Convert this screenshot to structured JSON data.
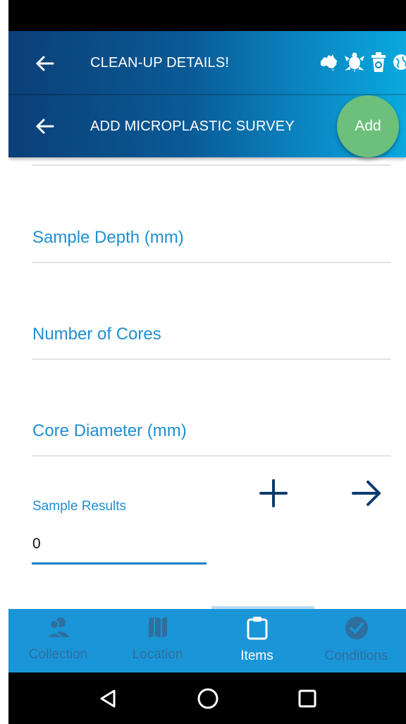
{
  "app_bar": {
    "title": "CLEAN-UP DETAILS!",
    "logo_icons": [
      "australia-map-icon",
      "turtle-icon",
      "recycle-bin-icon",
      "globe-icon"
    ]
  },
  "sub_bar": {
    "title": "ADD MICROPLASTIC SURVEY",
    "add_label": "Add"
  },
  "form": {
    "sample_depth_label": "Sample Depth (mm)",
    "number_of_cores_label": "Number of Cores",
    "core_diameter_label": "Core Diameter (mm)",
    "sample_results_label": "Sample Results",
    "sample_results_value": "0"
  },
  "bottom_nav": {
    "items": [
      {
        "label": "Collection",
        "icon": "people-icon",
        "active": false
      },
      {
        "label": "Location",
        "icon": "map-icon",
        "active": false
      },
      {
        "label": "Items",
        "icon": "clipboard-icon",
        "active": true
      },
      {
        "label": "Conditions",
        "icon": "check-circle-icon",
        "active": false
      }
    ]
  },
  "colors": {
    "header_dark": "#0b3f77",
    "header_light": "#0aa9de",
    "accent_blue": "#1f8fd1",
    "fab_green": "#6cc07b",
    "nav_blue": "#1a95d8",
    "nav_inactive": "#2f6f9d"
  }
}
